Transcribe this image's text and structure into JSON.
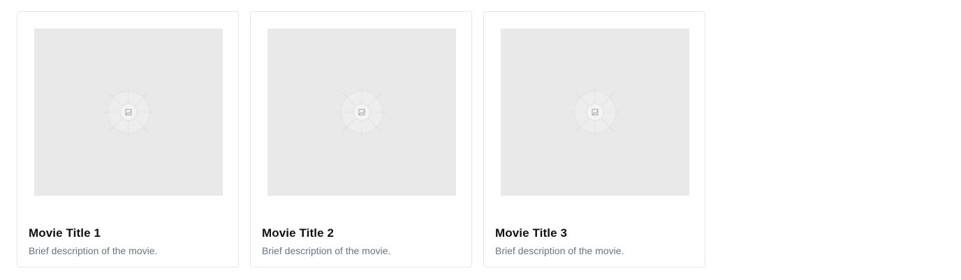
{
  "movies": [
    {
      "title": "Movie Title 1",
      "description": "Brief description of the movie.",
      "image_icon": "image-placeholder-icon"
    },
    {
      "title": "Movie Title 2",
      "description": "Brief description of the movie.",
      "image_icon": "image-placeholder-icon"
    },
    {
      "title": "Movie Title 3",
      "description": "Brief description of the movie.",
      "image_icon": "image-placeholder-icon"
    }
  ],
  "colors": {
    "card_border": "#e5e7eb",
    "placeholder_bg": "#e9e9e9",
    "title": "#111111",
    "description": "#6b7280"
  }
}
